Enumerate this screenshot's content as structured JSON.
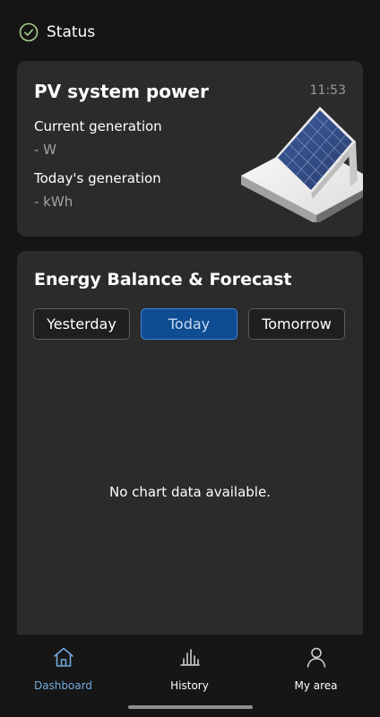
{
  "status": {
    "label": "Status",
    "icon": "check-circle-icon",
    "color": "#a8d08d"
  },
  "pv_card": {
    "title": "PV system power",
    "time": "11:53",
    "current_label": "Current generation",
    "current_value": "- W",
    "today_label": "Today's generation",
    "today_value": "- kWh",
    "illustration": "solar-panel-illustration"
  },
  "energy_card": {
    "title": "Energy Balance & Forecast",
    "tabs": [
      {
        "label": "Yesterday",
        "active": false
      },
      {
        "label": "Today",
        "active": true
      },
      {
        "label": "Tomorrow",
        "active": false
      }
    ],
    "empty_message": "No chart data available."
  },
  "bottom_nav": {
    "items": [
      {
        "label": "Dashboard",
        "icon": "home-icon",
        "active": true
      },
      {
        "label": "History",
        "icon": "bar-chart-icon",
        "active": false
      },
      {
        "label": "My area",
        "icon": "person-icon",
        "active": false
      }
    ]
  },
  "colors": {
    "background": "#151515",
    "card": "#2b2b2b",
    "accent": "#0f4d92",
    "accent_border": "#3d83d0",
    "nav_active": "#74a9dc"
  }
}
